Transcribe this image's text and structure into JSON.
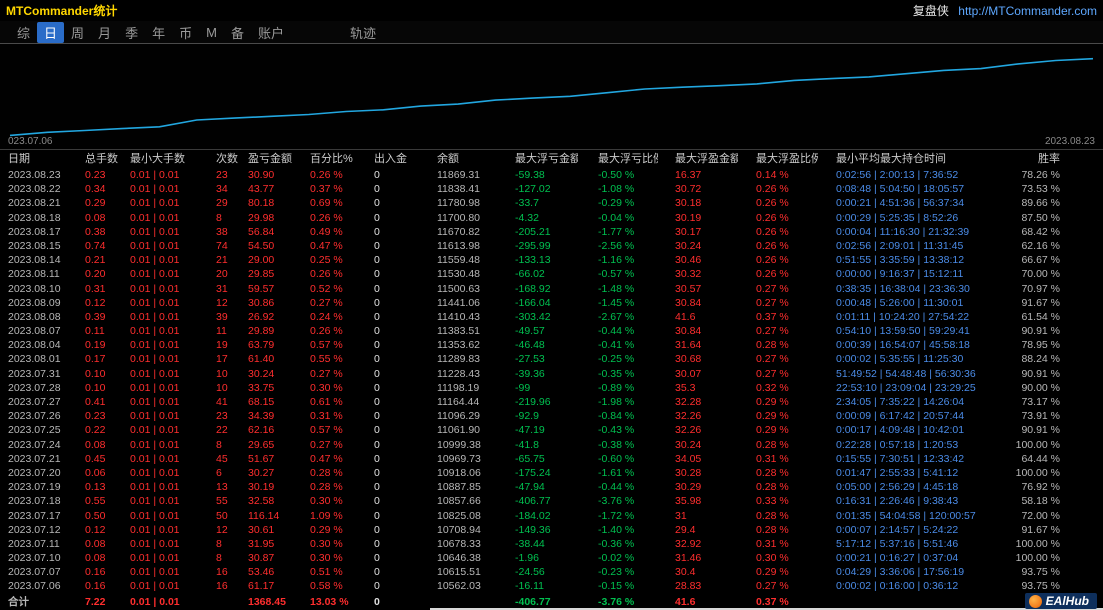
{
  "titlebar": {
    "title": "MTCommander统计",
    "brand": "复盘侠",
    "url": "http://MTCommander.com"
  },
  "menubar": {
    "items": [
      "综",
      "日",
      "周",
      "月",
      "季",
      "年",
      "币",
      "M",
      "备",
      "账户"
    ],
    "active_index": 1,
    "trailing_item": "轨迹"
  },
  "chart_data": {
    "type": "line",
    "title": "",
    "xlabel": "",
    "ylabel": "",
    "grid": false,
    "legend": "none",
    "line_color": "#22a7e0",
    "x_start_label": "023.07.06",
    "x_end_label": "2023.08.23",
    "ylim": [
      10450,
      11950
    ],
    "x": [
      "2023.07.06",
      "2023.07.07",
      "2023.07.10",
      "2023.07.11",
      "2023.07.12",
      "2023.07.17",
      "2023.07.18",
      "2023.07.19",
      "2023.07.20",
      "2023.07.21",
      "2023.07.24",
      "2023.07.25",
      "2023.07.26",
      "2023.07.27",
      "2023.07.28",
      "2023.07.31",
      "2023.08.01",
      "2023.08.04",
      "2023.08.07",
      "2023.08.08",
      "2023.08.09",
      "2023.08.10",
      "2023.08.11",
      "2023.08.14",
      "2023.08.15",
      "2023.08.17",
      "2023.08.18",
      "2023.08.21",
      "2023.08.22",
      "2023.08.23"
    ],
    "values": [
      10562.03,
      10615.51,
      10646.38,
      10678.33,
      10708.94,
      10825.08,
      10857.66,
      10887.85,
      10918.06,
      10969.73,
      10999.38,
      11061.9,
      11096.29,
      11164.44,
      11198.19,
      11228.43,
      11289.83,
      11353.62,
      11383.51,
      11410.43,
      11441.06,
      11500.63,
      11530.48,
      11559.48,
      11613.98,
      11670.82,
      11700.8,
      11780.98,
      11838.41,
      11869.31
    ]
  },
  "table": {
    "headers": [
      "日期",
      "总手数",
      "最小大手数",
      "次数",
      "盈亏金额",
      "百分比%",
      "出入金",
      "余额",
      "最大浮亏金额",
      "最大浮亏比例",
      "最大浮盈金额",
      "最大浮盈比例",
      "最小平均最大持仓时间",
      "胜率"
    ],
    "rows": [
      [
        "2023.08.23",
        "0.23",
        "0.01 | 0.01",
        "23",
        "30.90",
        "0.26 %",
        "0",
        "11869.31",
        "-59.38",
        "-0.50 %",
        "16.37",
        "0.14 %",
        "0:02:56 | 2:00:13 | 7:36:52",
        "78.26 %"
      ],
      [
        "2023.08.22",
        "0.34",
        "0.01 | 0.01",
        "34",
        "43.77",
        "0.37 %",
        "0",
        "11838.41",
        "-127.02",
        "-1.08 %",
        "30.72",
        "0.26 %",
        "0:08:48 | 5:04:50 | 18:05:57",
        "73.53 %"
      ],
      [
        "2023.08.21",
        "0.29",
        "0.01 | 0.01",
        "29",
        "80.18",
        "0.69 %",
        "0",
        "11780.98",
        "-33.7",
        "-0.29 %",
        "30.18",
        "0.26 %",
        "0:00:21 | 4:51:36 | 56:37:34",
        "89.66 %"
      ],
      [
        "2023.08.18",
        "0.08",
        "0.01 | 0.01",
        "8",
        "29.98",
        "0.26 %",
        "0",
        "11700.80",
        "-4.32",
        "-0.04 %",
        "30.19",
        "0.26 %",
        "0:00:29 | 5:25:35 | 8:52:26",
        "87.50 %"
      ],
      [
        "2023.08.17",
        "0.38",
        "0.01 | 0.01",
        "38",
        "56.84",
        "0.49 %",
        "0",
        "11670.82",
        "-205.21",
        "-1.77 %",
        "30.17",
        "0.26 %",
        "0:00:04 | 11:16:30 | 21:32:39",
        "68.42 %"
      ],
      [
        "2023.08.15",
        "0.74",
        "0.01 | 0.01",
        "74",
        "54.50",
        "0.47 %",
        "0",
        "11613.98",
        "-295.99",
        "-2.56 %",
        "30.24",
        "0.26 %",
        "0:02:56 | 2:09:01 | 11:31:45",
        "62.16 %"
      ],
      [
        "2023.08.14",
        "0.21",
        "0.01 | 0.01",
        "21",
        "29.00",
        "0.25 %",
        "0",
        "11559.48",
        "-133.13",
        "-1.16 %",
        "30.46",
        "0.26 %",
        "0:51:55 | 3:35:59 | 13:38:12",
        "66.67 %"
      ],
      [
        "2023.08.11",
        "0.20",
        "0.01 | 0.01",
        "20",
        "29.85",
        "0.26 %",
        "0",
        "11530.48",
        "-66.02",
        "-0.57 %",
        "30.32",
        "0.26 %",
        "0:00:00 | 9:16:37 | 15:12:11",
        "70.00 %"
      ],
      [
        "2023.08.10",
        "0.31",
        "0.01 | 0.01",
        "31",
        "59.57",
        "0.52 %",
        "0",
        "11500.63",
        "-168.92",
        "-1.48 %",
        "30.57",
        "0.27 %",
        "0:38:35 | 16:38:04 | 23:36:30",
        "70.97 %"
      ],
      [
        "2023.08.09",
        "0.12",
        "0.01 | 0.01",
        "12",
        "30.86",
        "0.27 %",
        "0",
        "11441.06",
        "-166.04",
        "-1.45 %",
        "30.84",
        "0.27 %",
        "0:00:48 | 5:26:00 | 11:30:01",
        "91.67 %"
      ],
      [
        "2023.08.08",
        "0.39",
        "0.01 | 0.01",
        "39",
        "26.92",
        "0.24 %",
        "0",
        "11410.43",
        "-303.42",
        "-2.67 %",
        "41.6",
        "0.37 %",
        "0:01:11 | 10:24:20 | 27:54:22",
        "61.54 %"
      ],
      [
        "2023.08.07",
        "0.11",
        "0.01 | 0.01",
        "11",
        "29.89",
        "0.26 %",
        "0",
        "11383.51",
        "-49.57",
        "-0.44 %",
        "30.84",
        "0.27 %",
        "0:54:10 | 13:59:50 | 59:29:41",
        "90.91 %"
      ],
      [
        "2023.08.04",
        "0.19",
        "0.01 | 0.01",
        "19",
        "63.79",
        "0.57 %",
        "0",
        "11353.62",
        "-46.48",
        "-0.41 %",
        "31.64",
        "0.28 %",
        "0:00:39 | 16:54:07 | 45:58:18",
        "78.95 %"
      ],
      [
        "2023.08.01",
        "0.17",
        "0.01 | 0.01",
        "17",
        "61.40",
        "0.55 %",
        "0",
        "11289.83",
        "-27.53",
        "-0.25 %",
        "30.68",
        "0.27 %",
        "0:00:02 | 5:35:55 | 11:25:30",
        "88.24 %"
      ],
      [
        "2023.07.31",
        "0.10",
        "0.01 | 0.01",
        "10",
        "30.24",
        "0.27 %",
        "0",
        "11228.43",
        "-39.36",
        "-0.35 %",
        "30.07",
        "0.27 %",
        "51:49:52 | 54:48:48 | 56:30:36",
        "90.91 %"
      ],
      [
        "2023.07.28",
        "0.10",
        "0.01 | 0.01",
        "10",
        "33.75",
        "0.30 %",
        "0",
        "11198.19",
        "-99",
        "-0.89 %",
        "35.3",
        "0.32 %",
        "22:53:10 | 23:09:04 | 23:29:25",
        "90.00 %"
      ],
      [
        "2023.07.27",
        "0.41",
        "0.01 | 0.01",
        "41",
        "68.15",
        "0.61 %",
        "0",
        "11164.44",
        "-219.96",
        "-1.98 %",
        "32.28",
        "0.29 %",
        "2:34:05 | 7:35:22 | 14:26:04",
        "73.17 %"
      ],
      [
        "2023.07.26",
        "0.23",
        "0.01 | 0.01",
        "23",
        "34.39",
        "0.31 %",
        "0",
        "11096.29",
        "-92.9",
        "-0.84 %",
        "32.26",
        "0.29 %",
        "0:00:09 | 6:17:42 | 20:57:44",
        "73.91 %"
      ],
      [
        "2023.07.25",
        "0.22",
        "0.01 | 0.01",
        "22",
        "62.16",
        "0.57 %",
        "0",
        "11061.90",
        "-47.19",
        "-0.43 %",
        "32.26",
        "0.29 %",
        "0:00:17 | 4:09:48 | 10:42:01",
        "90.91 %"
      ],
      [
        "2023.07.24",
        "0.08",
        "0.01 | 0.01",
        "8",
        "29.65",
        "0.27 %",
        "0",
        "10999.38",
        "-41.8",
        "-0.38 %",
        "30.24",
        "0.28 %",
        "0:22:28 | 0:57:18 | 1:20:53",
        "100.00 %"
      ],
      [
        "2023.07.21",
        "0.45",
        "0.01 | 0.01",
        "45",
        "51.67",
        "0.47 %",
        "0",
        "10969.73",
        "-65.75",
        "-0.60 %",
        "34.05",
        "0.31 %",
        "0:15:55 | 7:30:51 | 12:33:42",
        "64.44 %"
      ],
      [
        "2023.07.20",
        "0.06",
        "0.01 | 0.01",
        "6",
        "30.27",
        "0.28 %",
        "0",
        "10918.06",
        "-175.24",
        "-1.61 %",
        "30.28",
        "0.28 %",
        "0:01:47 | 2:55:33 | 5:41:12",
        "100.00 %"
      ],
      [
        "2023.07.19",
        "0.13",
        "0.01 | 0.01",
        "13",
        "30.19",
        "0.28 %",
        "0",
        "10887.85",
        "-47.94",
        "-0.44 %",
        "30.29",
        "0.28 %",
        "0:05:00 | 2:56:29 | 4:45:18",
        "76.92 %"
      ],
      [
        "2023.07.18",
        "0.55",
        "0.01 | 0.01",
        "55",
        "32.58",
        "0.30 %",
        "0",
        "10857.66",
        "-406.77",
        "-3.76 %",
        "35.98",
        "0.33 %",
        "0:16:31 | 2:26:46 | 9:38:43",
        "58.18 %"
      ],
      [
        "2023.07.17",
        "0.50",
        "0.01 | 0.01",
        "50",
        "116.14",
        "1.09 %",
        "0",
        "10825.08",
        "-184.02",
        "-1.72 %",
        "31",
        "0.28 %",
        "0:01:35 | 54:04:58 | 120:00:57",
        "72.00 %"
      ],
      [
        "2023.07.12",
        "0.12",
        "0.01 | 0.01",
        "12",
        "30.61",
        "0.29 %",
        "0",
        "10708.94",
        "-149.36",
        "-1.40 %",
        "29.4",
        "0.28 %",
        "0:00:07 | 2:14:57 | 5:24:22",
        "91.67 %"
      ],
      [
        "2023.07.11",
        "0.08",
        "0.01 | 0.01",
        "8",
        "31.95",
        "0.30 %",
        "0",
        "10678.33",
        "-38.44",
        "-0.36 %",
        "32.92",
        "0.31 %",
        "5:17:12 | 5:37:16 | 5:51:46",
        "100.00 %"
      ],
      [
        "2023.07.10",
        "0.08",
        "0.01 | 0.01",
        "8",
        "30.87",
        "0.30 %",
        "0",
        "10646.38",
        "-1.96",
        "-0.02 %",
        "31.46",
        "0.30 %",
        "0:00:21 | 0:16:27 | 0:37:04",
        "100.00 %"
      ],
      [
        "2023.07.07",
        "0.16",
        "0.01 | 0.01",
        "16",
        "53.46",
        "0.51 %",
        "0",
        "10615.51",
        "-24.56",
        "-0.23 %",
        "30.4",
        "0.29 %",
        "0:04:29 | 3:36:06 | 17:56:19",
        "93.75 %"
      ],
      [
        "2023.07.06",
        "0.16",
        "0.01 | 0.01",
        "16",
        "61.17",
        "0.58 %",
        "0",
        "10562.03",
        "-16.11",
        "-0.15 %",
        "28.83",
        "0.27 %",
        "0:00:02 | 0:16:00 | 0:36:12",
        "93.75 %"
      ]
    ],
    "total_row": [
      "合计",
      "7.22",
      "0.01 | 0.01",
      "",
      "1368.45",
      "13.03 %",
      "0",
      "",
      "-406.77",
      "-3.76 %",
      "41.6",
      "0.37 %",
      "",
      ""
    ]
  },
  "watermark": {
    "text": "EAlHub"
  },
  "colors": {
    "profit_red": "#ff2e2e",
    "loss_green": "#00c050",
    "time_blue": "#4b8ce8",
    "accent_line": "#22a7e0",
    "title_yellow": "#ffd700"
  }
}
